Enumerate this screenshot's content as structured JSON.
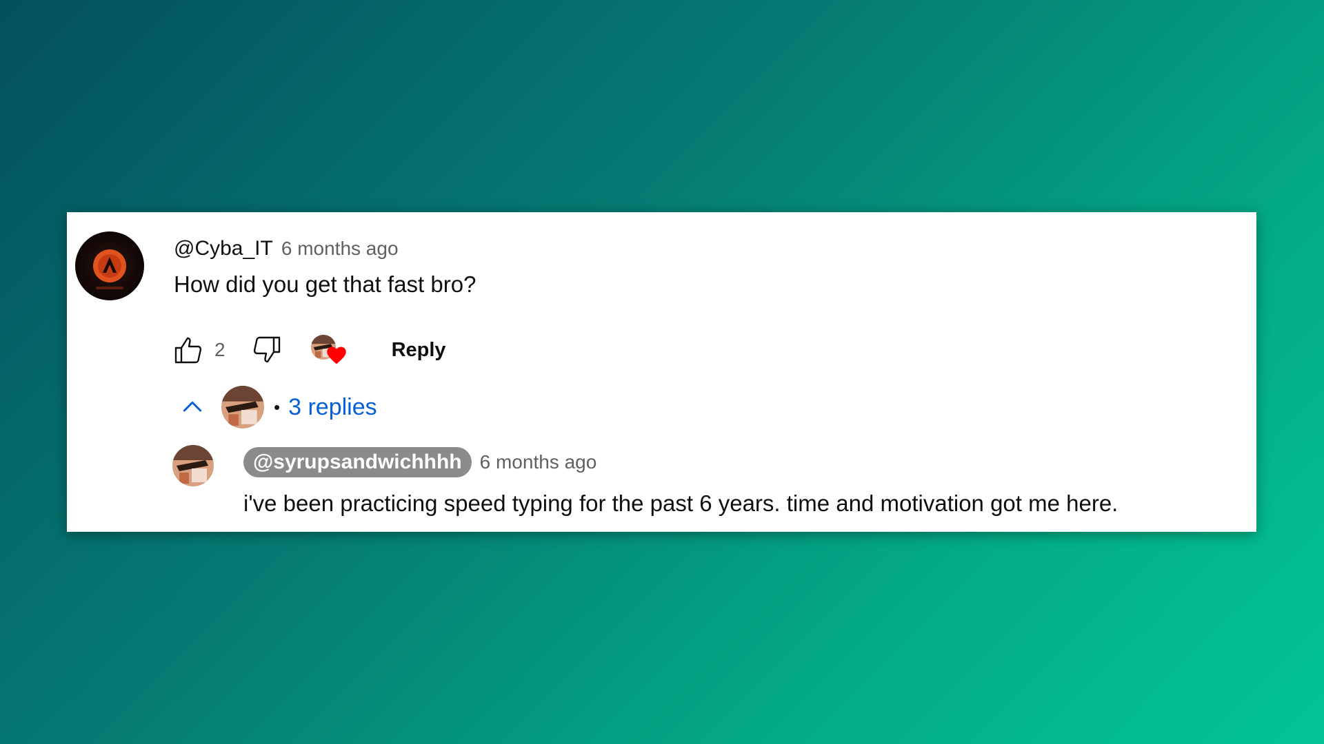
{
  "comment": {
    "author": "@Cyba_IT",
    "timestamp": "6 months ago",
    "text": "How did you get that fast bro?",
    "like_count": "2",
    "reply_label": "Reply",
    "avatar_icon": "channel-logo-icon"
  },
  "replies": {
    "dot": "•",
    "label": "3 replies"
  },
  "reply": {
    "author": "@syrupsandwichhhh",
    "timestamp": "6 months ago",
    "text": "i've been practicing speed typing for the past 6 years. time and motivation got me here."
  },
  "colors": {
    "background_start": "#03505c",
    "background_end": "#02c595",
    "link_blue": "#065fd4",
    "heart_red": "#ff0000",
    "chip_gray": "#8b8b8b",
    "text_primary": "#0f0f0f",
    "text_secondary": "#606060"
  }
}
